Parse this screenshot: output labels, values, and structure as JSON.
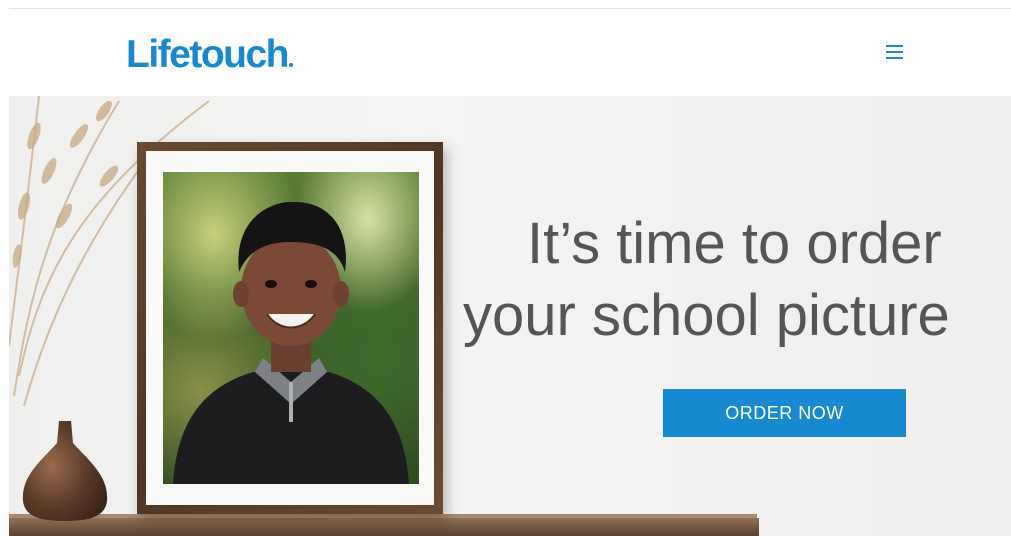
{
  "header": {
    "logo_text": "Lifetouch",
    "menu_icon": "hamburger-menu-icon",
    "brand_color": "#1689d0"
  },
  "hero": {
    "headline_line1": "It’s time to order",
    "headline_line2": "your school picture",
    "cta_label": "ORDER NOW",
    "cta_color": "#1689d0",
    "text_color": "#555557"
  }
}
